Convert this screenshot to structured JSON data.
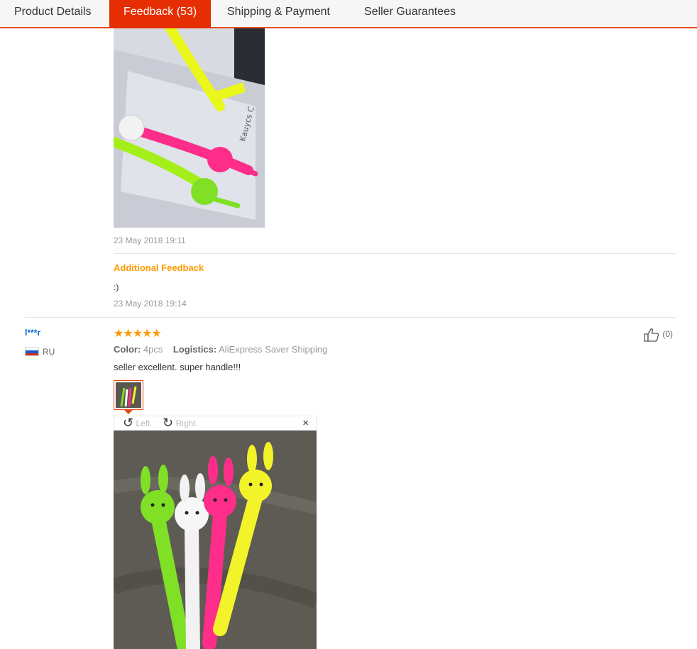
{
  "tabs": [
    {
      "label": "Product Details"
    },
    {
      "label": "Feedback (53)"
    },
    {
      "label": "Shipping & Payment"
    },
    {
      "label": "Seller Guarantees"
    }
  ],
  "review1": {
    "date": "23 May 2018 19:11",
    "additional_title": "Additional Feedback",
    "additional_text": ":)",
    "additional_date": "23 May 2018 19:14"
  },
  "review2": {
    "user": "l***r",
    "country": "RU",
    "stars": "★★★★★",
    "color_label": "Color:",
    "color_value": "4pcs",
    "logistics_label": "Logistics:",
    "logistics_value": "AliExpress Saver Shipping",
    "text": "seller excellent. super handle!!!",
    "helpful_count": "(0)",
    "rating": 5
  },
  "viewer": {
    "left_label": "Left",
    "right_label": "Right",
    "close": "×"
  },
  "colors": {
    "accent": "#e62e04",
    "orange": "#ff9900",
    "link": "#0066cc"
  }
}
